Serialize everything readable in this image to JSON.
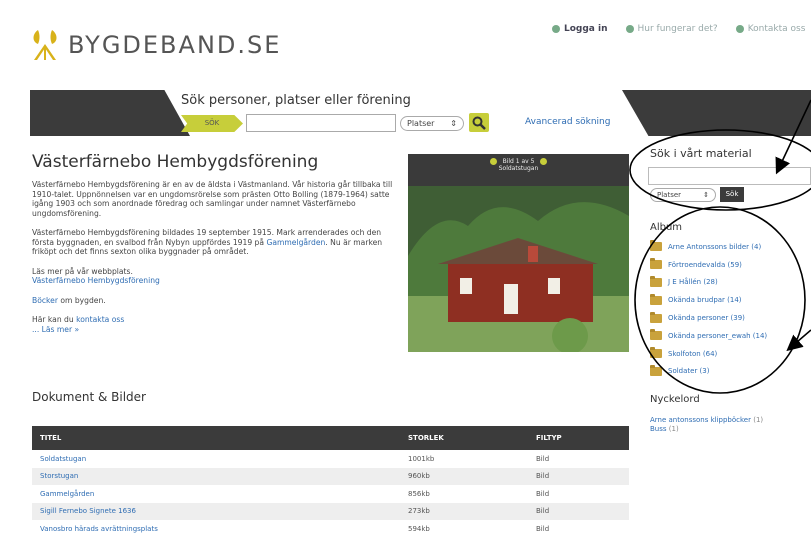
{
  "site": {
    "name": "BYGDEBAND.SE"
  },
  "top_links": [
    {
      "label": "Logga in",
      "bold": true
    },
    {
      "label": "Hur fungerar det?"
    },
    {
      "label": "Kontakta oss"
    }
  ],
  "search": {
    "title": "Sök personer, platser eller förening",
    "arrow_label": "SÖK",
    "input_value": "",
    "select_value": "Platser",
    "advanced_label": "Avancerad sökning"
  },
  "main": {
    "title": "Västerfärnebo Hembygdsförening",
    "paragraph1": "Västerfärnebo Hembygdsförening är en av de äldsta i Västmanland. Vår historia går tillbaka till 1910-talet. Uppnönnelsen var en ungdomsrörelse som prästen Otto Bolling (1879-1964) satte igång 1903 och som anordnade föredrag och samlingar under namnet Västerfärnebo ungdomsförening.",
    "paragraph2_a": "Västerfärnebo Hembygdsförening bildades 19 september 1915. Mark arrenderades och den första byggnaden, en svalbod från Nybyn uppfördes 1919 på ",
    "paragraph2_link": "Gammelgården",
    "paragraph2_b": ". Nu är marken friköpt och det finns sexton olika byggnader på området.",
    "read_more_text": "Läs mer på vår webbplats.",
    "read_more_link": "Västerfärnebo Hembygdsförening",
    "books_link": "Böcker",
    "books_text": " om bygden.",
    "contact_text": "Här kan du ",
    "contact_link": "kontakta oss",
    "more_link": "... Läs mer »",
    "docs_title": "Dokument & Bilder"
  },
  "image": {
    "counter": "Bild 1 av 5",
    "caption": "Soldatstugan"
  },
  "table": {
    "headers": [
      "TITEL",
      "STORLEK",
      "FILTYP"
    ],
    "rows": [
      {
        "title": "Soldatstugan",
        "size": "1001kb",
        "type": "Bild"
      },
      {
        "title": "Storstugan",
        "size": "960kb",
        "type": "Bild"
      },
      {
        "title": "Gammelgården",
        "size": "856kb",
        "type": "Bild"
      },
      {
        "title": "Sigill Fernebo Signete 1636",
        "size": "273kb",
        "type": "Bild"
      },
      {
        "title": "Vanosbro härads avrättningsplats",
        "size": "594kb",
        "type": "Bild"
      }
    ]
  },
  "sidebar": {
    "search_title": "Sök i vårt material",
    "search_value": "",
    "select_value": "Platser",
    "search_button": "Sök",
    "album_title": "Album",
    "albums": [
      "Arne Antonssons bilder (4)",
      "Förtroendevalda (59)",
      "J E Hållén (28)",
      "Okända brudpar (14)",
      "Okända personer (39)",
      "Okända personer_ewah (14)",
      "Skolfoton (64)",
      "Soldater (3)"
    ],
    "keywords_title": "Nyckelord",
    "keywords": [
      {
        "label": "Arne antonssons klippböcker",
        "count": "(1)"
      },
      {
        "label": "Buss",
        "count": "(1)"
      }
    ]
  },
  "colors": {
    "accent": "#c7ce3a",
    "dark": "#3b3b3b",
    "link": "#2f6db3",
    "folder": "#c9a23c"
  }
}
